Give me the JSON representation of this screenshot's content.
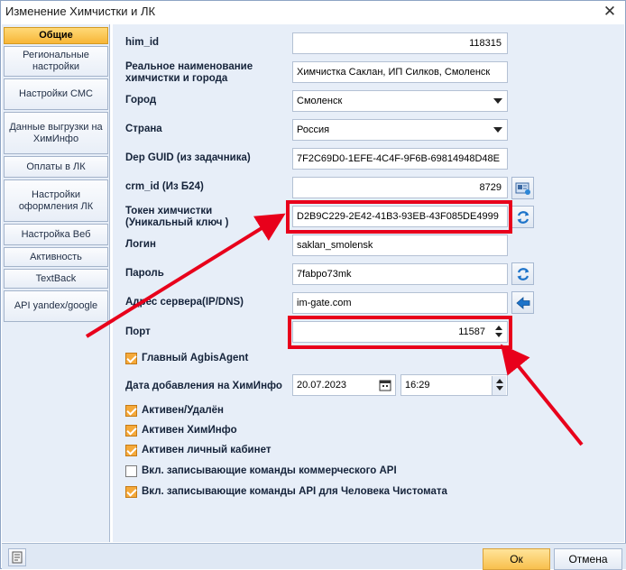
{
  "window": {
    "title": "Изменение Химчистки и ЛК",
    "close_glyph": "✕"
  },
  "sidebar": {
    "items": [
      {
        "label": "Общие",
        "active": true
      },
      {
        "label": "Региональные настройки"
      },
      {
        "label": "Настройки СМС"
      },
      {
        "label": "Данные выгрузки на ХимИнфо"
      },
      {
        "label": "Оплаты в ЛК"
      },
      {
        "label": "Настройки оформления ЛК"
      },
      {
        "label": "Настройка Веб"
      },
      {
        "label": "Активность"
      },
      {
        "label": "TextBack"
      },
      {
        "label": "API yandex/google"
      }
    ]
  },
  "form": {
    "him_id": {
      "label": "him_id",
      "value": "118315"
    },
    "real_name": {
      "label": "Реальное наименование химчистки и города",
      "value": "Химчистка Саклан, ИП Силков, Смоленск"
    },
    "city": {
      "label": "Город",
      "value": "Смоленск"
    },
    "country": {
      "label": "Страна",
      "value": "Россия"
    },
    "dep_guid": {
      "label": "Dep GUID (из задачника)",
      "value": "7F2C69D0-1EFE-4C4F-9F6B-69814948D48E"
    },
    "crm_id": {
      "label": "crm_id (Из Б24)",
      "value": "8729"
    },
    "token": {
      "label": "Токен химчистки (Уникальный ключ )",
      "value": "D2B9C229-2E42-41B3-93EB-43F085DE4999"
    },
    "login": {
      "label": "Логин",
      "value": "saklan_smolensk"
    },
    "password": {
      "label": "Пароль",
      "value": "7fabpo73mk"
    },
    "server": {
      "label": "Адрес сервера(IP/DNS)",
      "value": "im-gate.com"
    },
    "port": {
      "label": "Порт",
      "value": "11587"
    },
    "main_agent": {
      "label": "Главный AgbisAgent",
      "checked": true
    },
    "date_added": {
      "label": "Дата добавления на ХимИнфо",
      "date": "20.07.2023",
      "time": "16:29"
    },
    "checks": [
      {
        "label": "Активен/Удалён",
        "checked": true
      },
      {
        "label": "Активен ХимИнфо",
        "checked": true
      },
      {
        "label": "Активен личный кабинет",
        "checked": true
      },
      {
        "label": "Вкл. записывающие команды коммерческого API",
        "checked": false
      },
      {
        "label": "Вкл. записывающие команды API для Человека Чистомата",
        "checked": true
      }
    ]
  },
  "icons": {
    "crm_button": "card-refresh-icon",
    "token_refresh": "refresh-icon",
    "password_refresh": "refresh-icon",
    "server_button": "arrow-left-icon",
    "date_picker": "calendar-icon",
    "help": "help-icon"
  },
  "footer": {
    "ok_label": "Ок",
    "cancel_label": "Отмена"
  },
  "colors": {
    "accent": "#f8c04d",
    "highlight": "#e8001b",
    "panel": "#e7eef8"
  }
}
